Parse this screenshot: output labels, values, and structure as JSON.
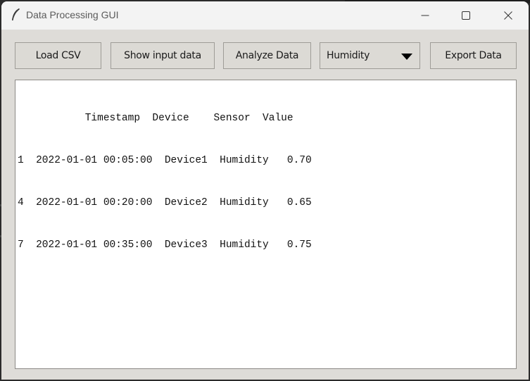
{
  "window": {
    "title": "Data Processing GUI"
  },
  "icons": {
    "app": "feather-icon",
    "minimize": "minimize-icon",
    "maximize": "maximize-icon",
    "close": "close-icon",
    "dropdown": "caret-down-icon"
  },
  "toolbar": {
    "load_label": "Load CSV",
    "show_label": "Show input data",
    "analyze_label": "Analyze Data",
    "sensor_select_value": "Humidity",
    "export_label": "Export Data"
  },
  "output": {
    "header": "           Timestamp  Device    Sensor  Value",
    "rows": [
      "1  2022-01-01 00:05:00  Device1  Humidity   0.70",
      "4  2022-01-01 00:20:00  Device2  Humidity   0.65",
      "7  2022-01-01 00:35:00  Device3  Humidity   0.75"
    ]
  },
  "colors": {
    "window_bg": "#dedcd8",
    "titlebar_bg": "#f3f3f3",
    "text_area_bg": "#ffffff"
  }
}
